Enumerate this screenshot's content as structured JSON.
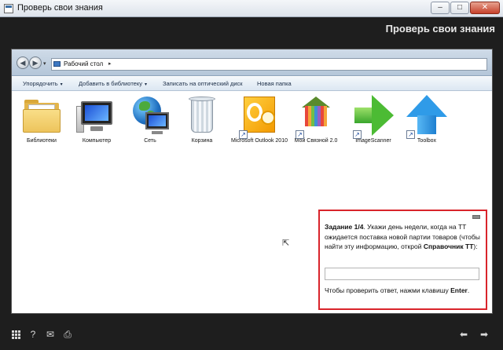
{
  "window": {
    "title": "Проверь свои знания",
    "buttons": {
      "minimize": "–",
      "maximize": "□",
      "close": "✕"
    }
  },
  "header": {
    "title": "Проверь свои знания"
  },
  "explorer": {
    "nav": {
      "back": "◀",
      "forward": "▶",
      "dropdown": "▾"
    },
    "address": {
      "text": "Рабочий стол",
      "arrow": "▸"
    },
    "commands": [
      "Упорядочить",
      "Добавить в библиотеку",
      "Записать на оптический диск",
      "Новая папка"
    ],
    "dropdown_glyph": "▾",
    "icons": [
      {
        "label": "Библиотеки",
        "icon": "libraries-folder-icon"
      },
      {
        "label": "Компьютер",
        "icon": "computer-icon"
      },
      {
        "label": "Сеть",
        "icon": "network-icon"
      },
      {
        "label": "Корзина",
        "icon": "recycle-bin-icon"
      },
      {
        "label": "Microsoft Outlook 2010",
        "icon": "outlook-icon"
      },
      {
        "label": "Мой Связной 2.0",
        "icon": "svyaznoy-icon"
      },
      {
        "label": "ImageScanner",
        "icon": "green-arrow-icon"
      },
      {
        "label": "Toolbox",
        "icon": "blue-arrow-icon"
      }
    ],
    "shortcut_glyph": "↗"
  },
  "task": {
    "number": "Задание 1/4",
    "text_before": ". Укажи день недели, когда на ТТ ожидается поставка новой партии товаров (чтобы найти эту информацию, открой ",
    "link_name": "Справочник ТТ",
    "text_after": "):",
    "answer_value": "",
    "hint_before": "Чтобы проверить ответ, нажми клавишу ",
    "hint_key": "Enter",
    "hint_after": "."
  },
  "footer": {
    "help": "?",
    "mail": "✉",
    "print": "⎙",
    "prev": "⬅",
    "next": "➡"
  },
  "cursor_glyph": "⇱"
}
